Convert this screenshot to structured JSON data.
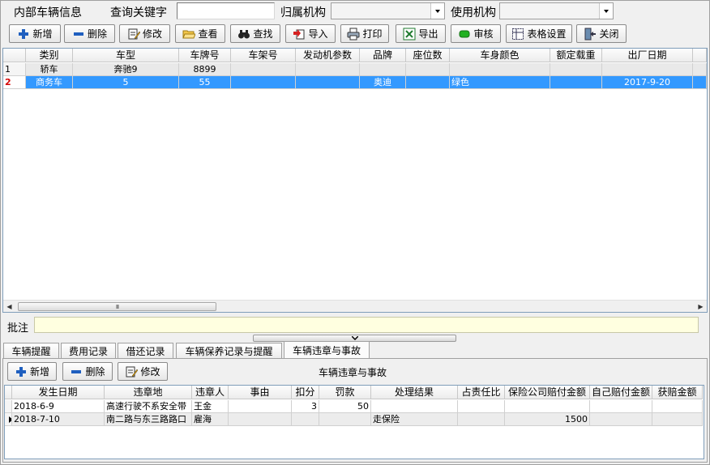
{
  "header": {
    "title": "内部车辆信息",
    "keyword_label": "查询关键字",
    "keyword_value": "",
    "owner_label": "归属机构",
    "owner_value": "",
    "user_label": "使用机构",
    "user_value": ""
  },
  "toolbar": {
    "add": "新增",
    "delete": "删除",
    "edit": "修改",
    "view": "查看",
    "find": "查找",
    "import": "导入",
    "print": "打印",
    "export": "导出",
    "audit": "审核",
    "table_settings": "表格设置",
    "close": "关闭"
  },
  "vehicles": {
    "columns": [
      "类别",
      "车型",
      "车牌号",
      "车架号",
      "发动机参数",
      "品牌",
      "座位数",
      "车身颜色",
      "额定载重",
      "出厂日期"
    ],
    "rows": [
      {
        "num": "1",
        "cells": [
          "轿车",
          "奔驰9",
          "8899",
          "",
          "",
          "",
          "",
          "",
          "",
          ""
        ]
      },
      {
        "num": "2",
        "cells": [
          "商务车",
          "5",
          "55",
          "",
          "",
          "奥迪",
          "",
          "绿色",
          "",
          "2017-9-20"
        ]
      }
    ]
  },
  "scroll_thumb_label": "III",
  "remark_label": "批注",
  "remark_value": "",
  "tabs": [
    "车辆提醒",
    "费用记录",
    "借还记录",
    "车辆保养记录与提醒",
    "车辆违章与事故"
  ],
  "violations": {
    "title": "车辆违章与事故",
    "add": "新增",
    "delete": "删除",
    "edit": "修改",
    "columns": [
      "发生日期",
      "违章地",
      "违章人",
      "事由",
      "扣分",
      "罚款",
      "处理结果",
      "占责任比",
      "保险公司赔付金额",
      "自己赔付金额",
      "获赔金额"
    ],
    "rows": [
      {
        "cells": [
          "2018-6-9",
          "高速行驶不系安全带",
          "王金",
          "",
          "3",
          "50",
          "",
          "",
          "",
          "",
          ""
        ]
      },
      {
        "cells": [
          "2018-7-10",
          "南二路与东三路路口",
          "雇海",
          "",
          "",
          "",
          "走保险",
          "",
          "1500",
          "",
          ""
        ]
      }
    ]
  },
  "colors": {
    "selection": "#3399ff",
    "grid_border": "#7f9db9",
    "remark_bg": "#ffffe0"
  }
}
